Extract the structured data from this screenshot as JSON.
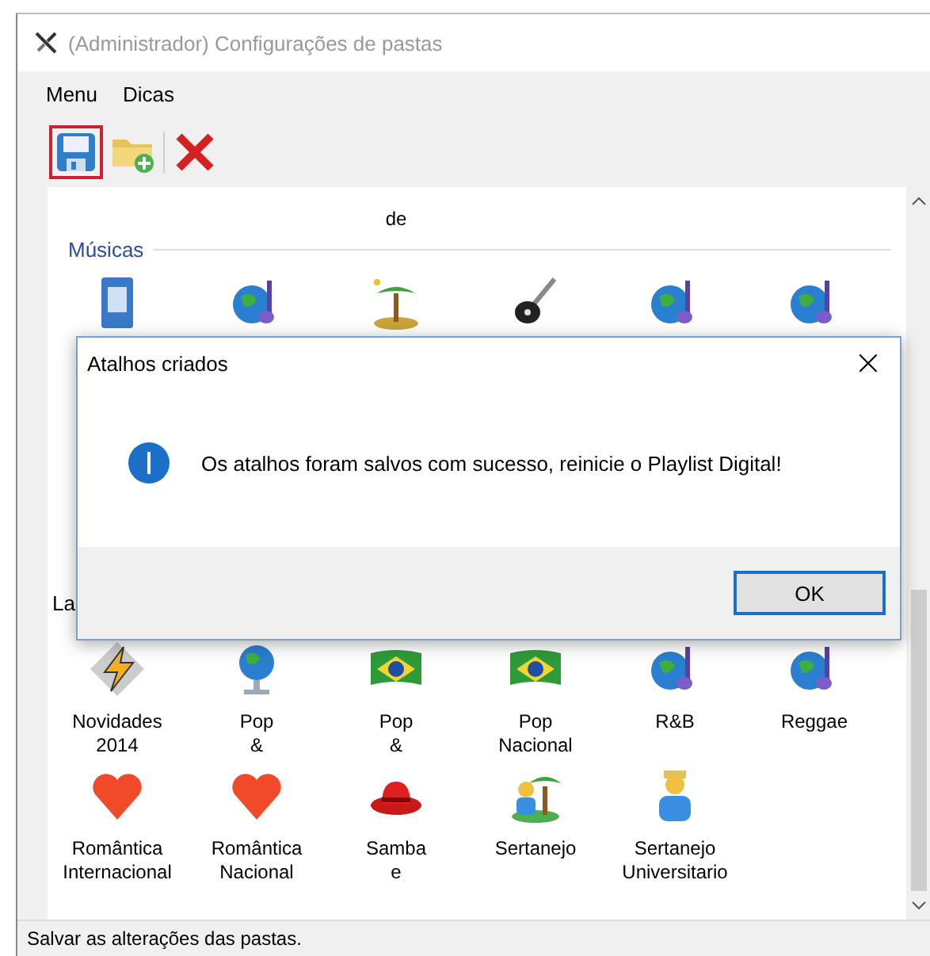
{
  "window": {
    "title": "(Administrador) Configurações de pastas"
  },
  "menu": [
    "Menu",
    "Dicas"
  ],
  "toolbar": [
    {
      "kind": "save",
      "selected": true
    },
    {
      "kind": "new-folder",
      "selected": false
    },
    {
      "kind": "delete",
      "selected": false
    }
  ],
  "partial_labels": [
    "de"
  ],
  "musicas": {
    "title": "Músicas",
    "icons": [
      {
        "kind": "document"
      },
      {
        "kind": "globe-note"
      },
      {
        "kind": "palm"
      },
      {
        "kind": "guitar"
      },
      {
        "kind": "globe-note"
      },
      {
        "kind": "globe-note"
      }
    ]
  },
  "section_2": {
    "title": "La"
  },
  "rows": [
    [
      {
        "kind": "lightning",
        "label": "Novidades\n2014"
      },
      {
        "kind": "globe",
        "label": "Pop\n&"
      },
      {
        "kind": "flag",
        "label": "Pop\n&"
      },
      {
        "kind": "flag",
        "label": "Pop\nNacional"
      },
      {
        "kind": "globe-note",
        "label": "R&B"
      },
      {
        "kind": "globe-note",
        "label": "Reggae"
      }
    ],
    [
      {
        "kind": "heart",
        "label": "Romântica\nInternacional"
      },
      {
        "kind": "heart",
        "label": "Romântica\nNacional"
      },
      {
        "kind": "hat",
        "label": "Samba\ne"
      },
      {
        "kind": "palm-person",
        "label": "Sertanejo"
      },
      {
        "kind": "person",
        "label": "Sertanejo\nUniversitario"
      }
    ]
  ],
  "dialog": {
    "title": "Atalhos criados",
    "close": "×",
    "message": "Os atalhos foram salvos com sucesso, reinicie o Playlist Digital!",
    "button": "OK"
  },
  "status_bar": "Salvar as alterações das pastas."
}
